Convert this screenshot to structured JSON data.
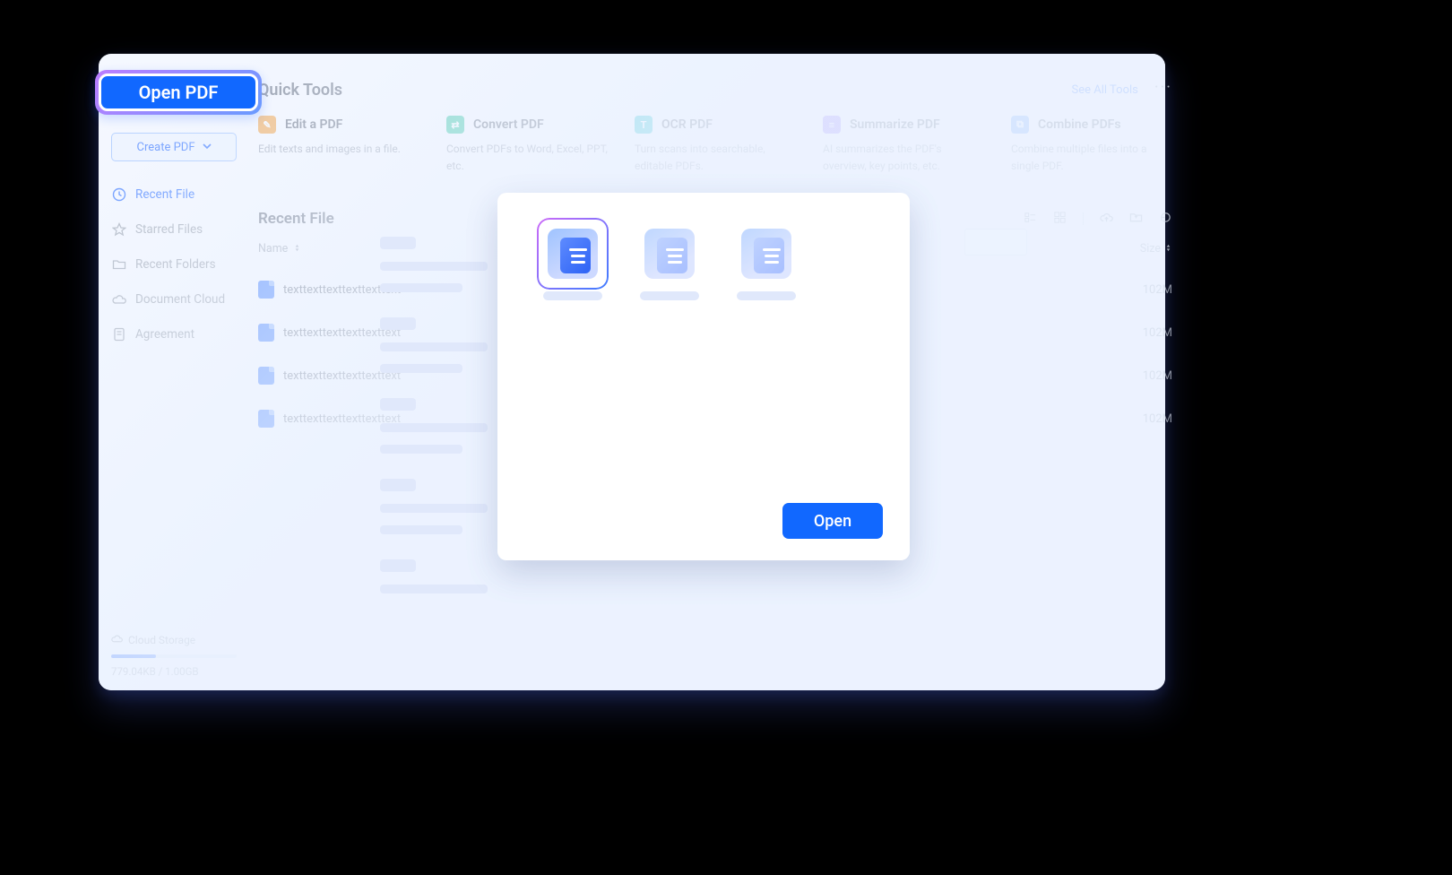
{
  "sidebar": {
    "open_pdf": "Open PDF",
    "create_pdf": "Create PDF",
    "nav": [
      {
        "id": "recent",
        "label": "Recent File",
        "active": true
      },
      {
        "id": "starred",
        "label": "Starred Files",
        "active": false
      },
      {
        "id": "folders",
        "label": "Recent Folders",
        "active": false
      },
      {
        "id": "cloud",
        "label": "Document Cloud",
        "active": false
      },
      {
        "id": "agree",
        "label": "Agreement",
        "active": false
      }
    ],
    "storage_label": "Cloud Storage",
    "storage_usage": "779.04KB / 1.00GB"
  },
  "quick_tools": {
    "title": "Quick Tools",
    "see_all": "See All Tools",
    "items": [
      {
        "label": "Edit a PDF",
        "desc": "Edit texts and images in a file.",
        "color": "#f6a84b"
      },
      {
        "label": "Convert PDF",
        "desc": "Convert PDFs to Word, Excel, PPT, etc.",
        "color": "#3ac9a4"
      },
      {
        "label": "OCR PDF",
        "desc": "Turn scans into searchable, editable PDFs.",
        "color": "#34c8d4"
      },
      {
        "label": "Summarize PDF",
        "desc": "AI summarizes the PDF's overview, key points, etc.",
        "color": "#9b7bff"
      },
      {
        "label": "Combine PDFs",
        "desc": "Combine multiple files into a single PDF.",
        "color": "#6fa8ff"
      }
    ]
  },
  "recent": {
    "title": "Recent File",
    "col_name": "Name",
    "col_size": "Size",
    "rows": [
      {
        "name": "texttexttexttexttexttext",
        "size": "102M"
      },
      {
        "name": "texttexttexttexttexttext",
        "size": "102M"
      },
      {
        "name": "texttexttexttexttexttext",
        "size": "102M"
      },
      {
        "name": "texttexttexttexttexttext",
        "size": "102M"
      }
    ]
  },
  "popover": {
    "open": "Open"
  }
}
